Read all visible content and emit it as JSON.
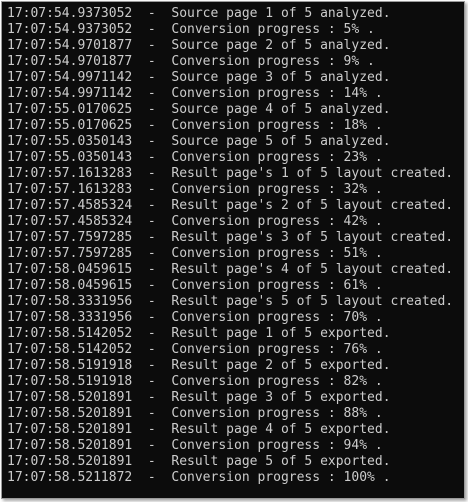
{
  "console": {
    "lines": [
      {
        "time": "17:07:54.9373052",
        "message": "Source page 1 of 5 analyzed."
      },
      {
        "time": "17:07:54.9373052",
        "message": "Conversion progress : 5% ."
      },
      {
        "time": "17:07:54.9701877",
        "message": "Source page 2 of 5 analyzed."
      },
      {
        "time": "17:07:54.9701877",
        "message": "Conversion progress : 9% ."
      },
      {
        "time": "17:07:54.9971142",
        "message": "Source page 3 of 5 analyzed."
      },
      {
        "time": "17:07:54.9971142",
        "message": "Conversion progress : 14% ."
      },
      {
        "time": "17:07:55.0170625",
        "message": "Source page 4 of 5 analyzed."
      },
      {
        "time": "17:07:55.0170625",
        "message": "Conversion progress : 18% ."
      },
      {
        "time": "17:07:55.0350143",
        "message": "Source page 5 of 5 analyzed."
      },
      {
        "time": "17:07:55.0350143",
        "message": "Conversion progress : 23% ."
      },
      {
        "time": "17:07:57.1613283",
        "message": "Result page's 1 of 5 layout created."
      },
      {
        "time": "17:07:57.1613283",
        "message": "Conversion progress : 32% ."
      },
      {
        "time": "17:07:57.4585324",
        "message": "Result page's 2 of 5 layout created."
      },
      {
        "time": "17:07:57.4585324",
        "message": "Conversion progress : 42% ."
      },
      {
        "time": "17:07:57.7597285",
        "message": "Result page's 3 of 5 layout created."
      },
      {
        "time": "17:07:57.7597285",
        "message": "Conversion progress : 51% ."
      },
      {
        "time": "17:07:58.0459615",
        "message": "Result page's 4 of 5 layout created."
      },
      {
        "time": "17:07:58.0459615",
        "message": "Conversion progress : 61% ."
      },
      {
        "time": "17:07:58.3331956",
        "message": "Result page's 5 of 5 layout created."
      },
      {
        "time": "17:07:58.3331956",
        "message": "Conversion progress : 70% ."
      },
      {
        "time": "17:07:58.5142052",
        "message": "Result page 1 of 5 exported."
      },
      {
        "time": "17:07:58.5142052",
        "message": "Conversion progress : 76% ."
      },
      {
        "time": "17:07:58.5191918",
        "message": "Result page 2 of 5 exported."
      },
      {
        "time": "17:07:58.5191918",
        "message": "Conversion progress : 82% ."
      },
      {
        "time": "17:07:58.5201891",
        "message": "Result page 3 of 5 exported."
      },
      {
        "time": "17:07:58.5201891",
        "message": "Conversion progress : 88% ."
      },
      {
        "time": "17:07:58.5201891",
        "message": "Result page 4 of 5 exported."
      },
      {
        "time": "17:07:58.5201891",
        "message": "Conversion progress : 94% ."
      },
      {
        "time": "17:07:58.5201891",
        "message": "Result page 5 of 5 exported."
      },
      {
        "time": "17:07:58.5211872",
        "message": "Conversion progress : 100% ."
      }
    ]
  }
}
